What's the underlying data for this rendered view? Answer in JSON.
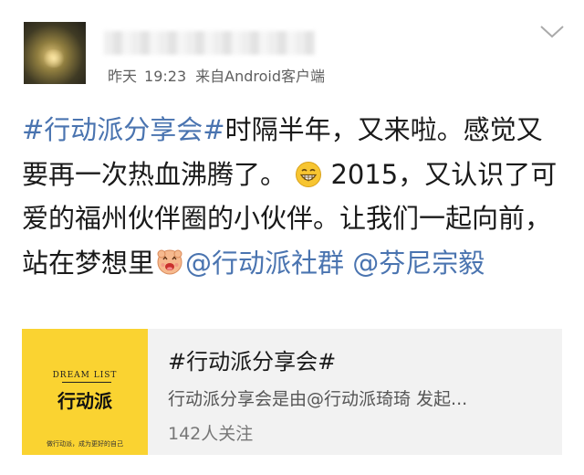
{
  "post": {
    "time_day": "昨天",
    "time_clock": "19:23",
    "source": "来自Android客户端",
    "content": {
      "hashtag": "#行动派分享会#",
      "text1": "时隔半年，又来啦。感觉又要再一次热血沸腾了。",
      "emoji1": "grinning-face-icon",
      "text2": " 2015，又认识了可爱的福州伙伴圈的小伙伴。让我们一起向前，站在梦想里",
      "emoji2": "excited-face-icon",
      "mention1": "@行动派社群",
      "mention2": "@芬尼宗毅"
    }
  },
  "card": {
    "thumb": {
      "brand_en": "DREAM LIST",
      "brand_cn": "行动派",
      "slogan": "做行动派，成为更好的自己"
    },
    "title": "#行动派分享会#",
    "description": "行动派分享会是由@行动派琦琦 发起...",
    "followers": "142人关注"
  },
  "colors": {
    "link": "#4a74b0",
    "text": "#1a1a1a",
    "meta": "#5f5f5f",
    "card_bg": "#f2f2f2",
    "thumb_bg": "#fad331"
  }
}
